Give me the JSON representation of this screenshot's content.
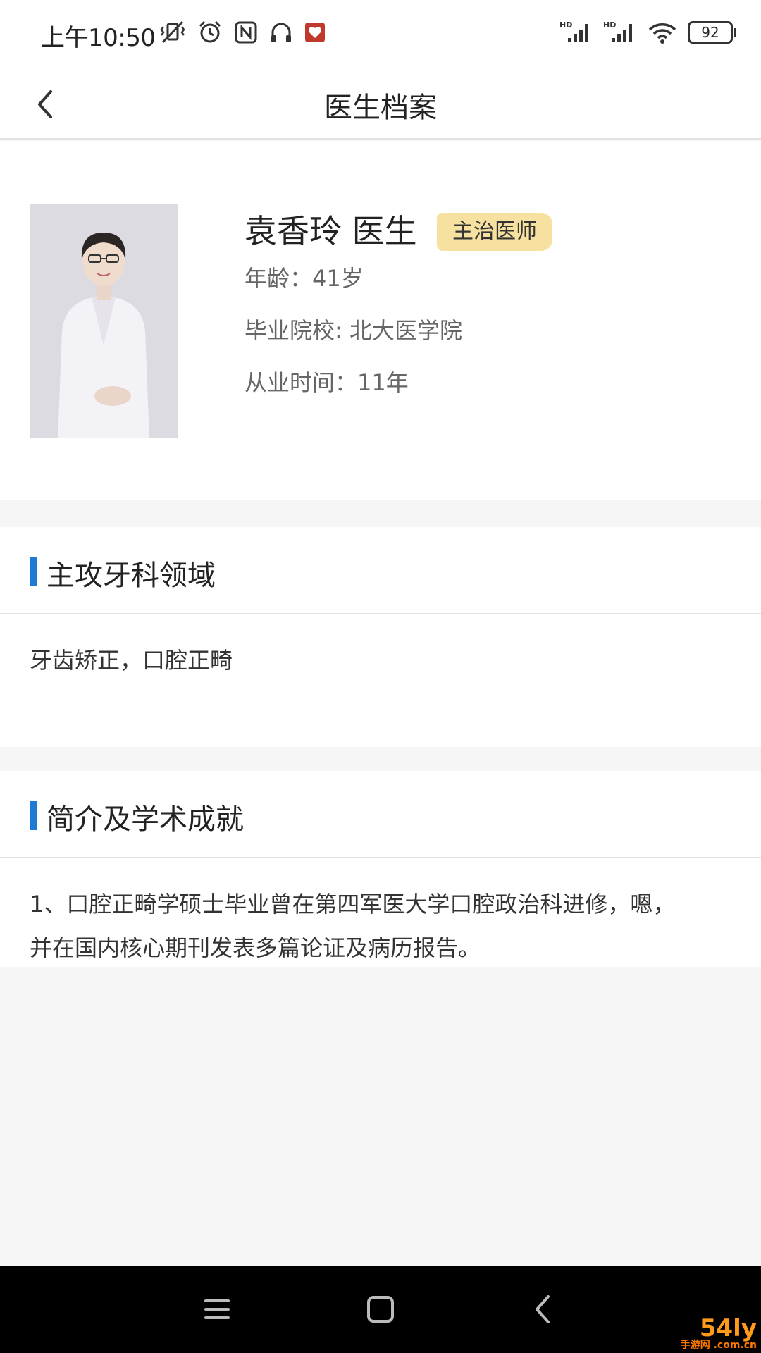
{
  "status_bar": {
    "time": "上午10:50",
    "battery": "92",
    "icons_left": [
      "mute-vibrate-icon",
      "alarm-icon",
      "nfc-icon",
      "headphones-icon",
      "app-notification-icon"
    ],
    "icons_right": [
      "hd-signal-icon",
      "hd-signal-icon",
      "wifi-icon",
      "battery-icon"
    ]
  },
  "nav": {
    "title": "医生档案"
  },
  "profile": {
    "name": "袁香玲 医生",
    "badge": "主治医师",
    "age": "年龄：41岁",
    "school": "毕业院校: 北大医学院",
    "experience": "从业时间：11年"
  },
  "specialty": {
    "title": "主攻牙科领域",
    "content": "牙齿矫正，口腔正畸"
  },
  "intro": {
    "title": "简介及学术成就",
    "line1": "1、口腔正畸学硕士毕业曾在第四军医大学口腔政治科进修，嗯，",
    "line2": "并在国内核心期刊发表多篇论证及病历报告。"
  },
  "watermark": {
    "main": "54ly",
    "sub": "手游网 .com.cn"
  },
  "colors": {
    "accent": "#1f7ad6",
    "badge_bg": "#f7e1a0",
    "watermark": "#ff9a1a"
  }
}
